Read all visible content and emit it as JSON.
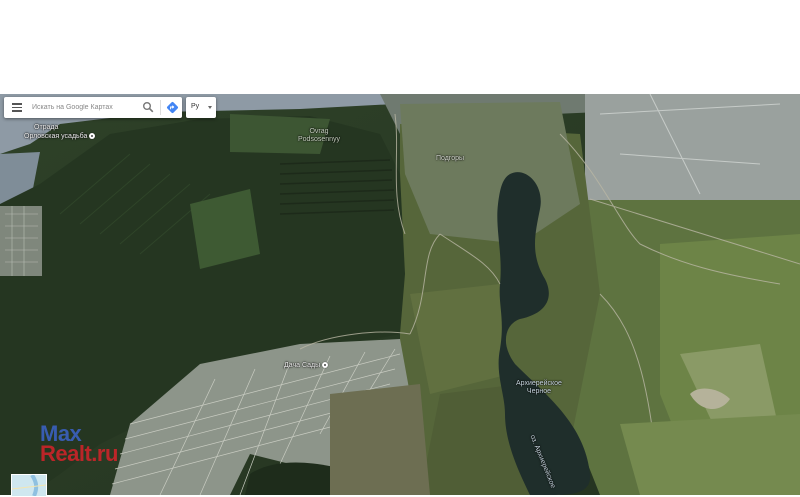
{
  "search": {
    "placeholder": "Искать на Google Картах"
  },
  "language": {
    "label": "Ру"
  },
  "map_labels": {
    "otrada": "Отрада",
    "orlovskaya": "Орловская усадьба",
    "ovrag_line1": "Ovrag",
    "ovrag_line2": "Podsosennyy",
    "podgory": "Подгоры",
    "dacha_sady": "Дача Сады",
    "lake_line1": "Архиерейское",
    "lake_line2": "Черное",
    "lake_edge": "оз. Архиерейское"
  },
  "watermark": {
    "line1": "Max",
    "line2": "Realt.ru"
  },
  "icons": [
    "menu-icon",
    "search-icon",
    "directions-icon",
    "place-pin-icon",
    "caret-down-icon"
  ],
  "colors": {
    "accent": "#4285f4",
    "watermark_blue": "#3c63c9",
    "watermark_red": "#d6232a"
  }
}
